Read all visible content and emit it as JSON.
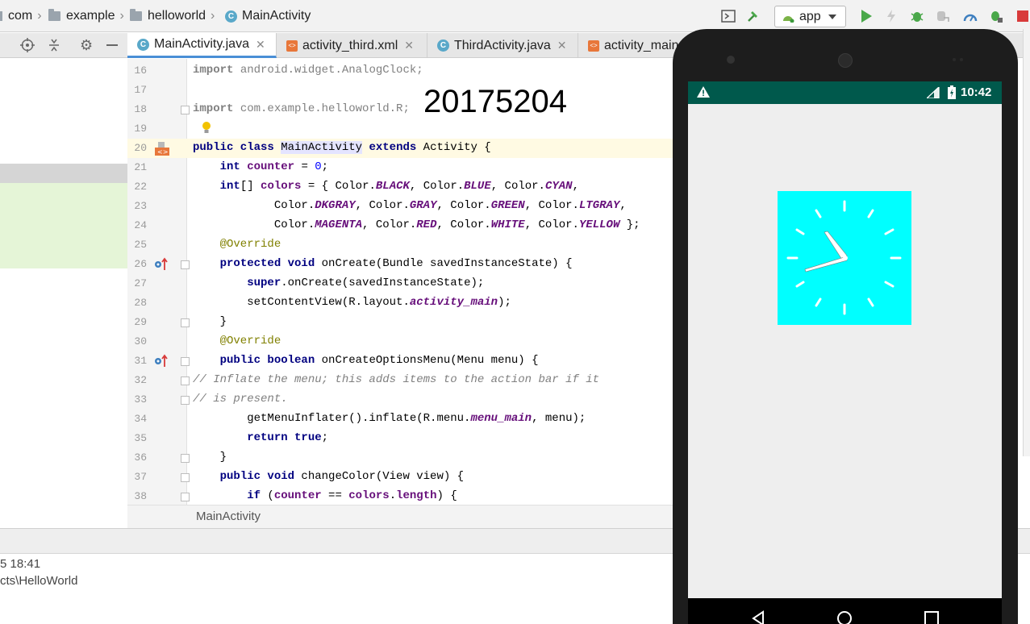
{
  "breadcrumb": {
    "items": [
      "com",
      "example",
      "helloworld",
      "MainActivity"
    ]
  },
  "toolbar": {
    "run_config": "app"
  },
  "tabs": [
    {
      "label": "MainActivity.java",
      "type": "java",
      "active": true
    },
    {
      "label": "activity_third.xml",
      "type": "xml",
      "active": false
    },
    {
      "label": "ThirdActivity.java",
      "type": "java",
      "active": false
    },
    {
      "label": "activity_main",
      "type": "xml",
      "active": false
    }
  ],
  "editor": {
    "line_numbers": [
      "16",
      "17",
      "18",
      "19",
      "20",
      "21",
      "22",
      "23",
      "24",
      "25",
      "26",
      "27",
      "28",
      "29",
      "30",
      "31",
      "32",
      "33",
      "34",
      "35",
      "36",
      "37",
      "38"
    ],
    "overlay_number": "20175204",
    "crumb": "MainActivity"
  },
  "bottom": {
    "line1": "5 18:41",
    "line2": "cts\\HelloWorld"
  },
  "phone": {
    "time": "10:42"
  },
  "colors": {
    "accent": "#4a8fd6",
    "status_bar": "#00594c",
    "clock_bg": "#00ffff",
    "caret_line": "#fffae3"
  }
}
